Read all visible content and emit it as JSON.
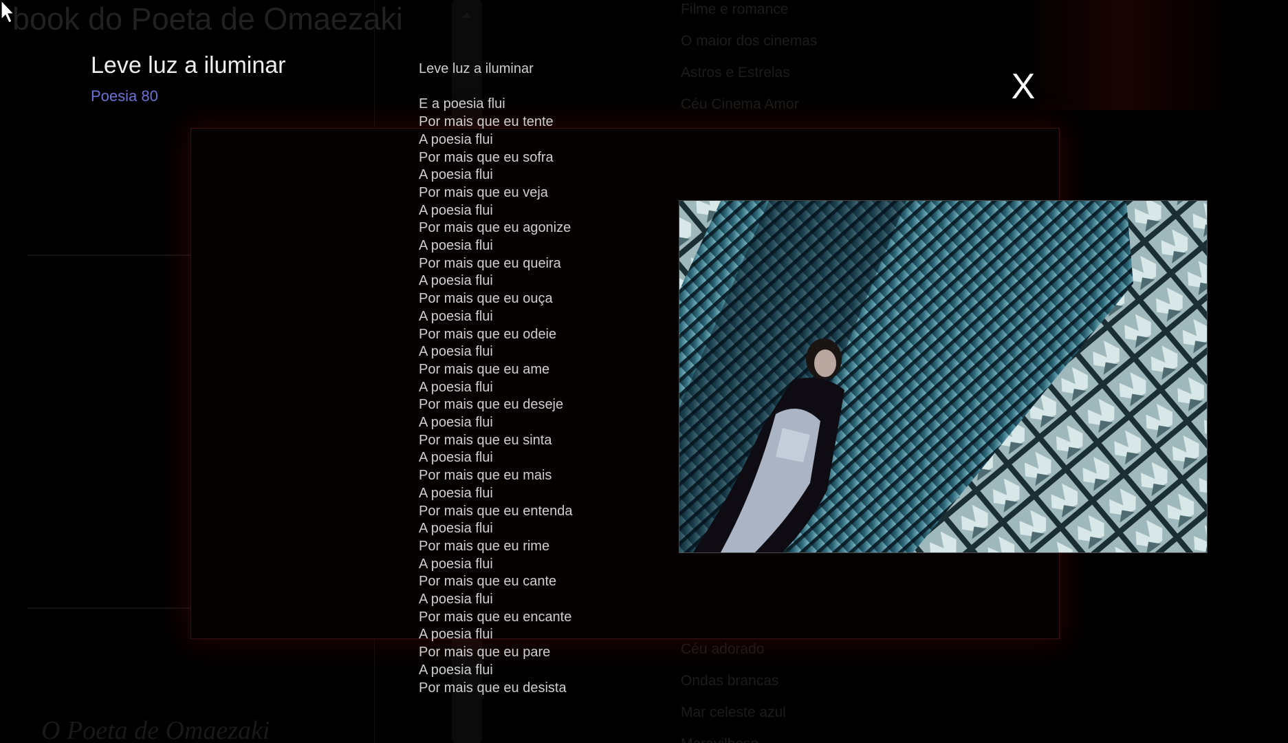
{
  "background": {
    "site_title": "book do Poeta de Omaezaki",
    "nav_links_top": [
      "Filme e romance",
      "O maior dos cinemas",
      "Astros e Estrelas",
      "Céu Cinema Amor"
    ],
    "nav_links_bottom": [
      "Céu adorado",
      "Ondas brancas",
      "Mar celeste azul",
      "Maravilhoso"
    ],
    "footer_title": "O Poeta de Omaezaki"
  },
  "poem": {
    "title": "Leve luz a iluminar",
    "number_label": "Poesia 80",
    "heading": "Leve luz a iluminar",
    "lines": [
      "E a poesia flui",
      "Por mais que eu tente",
      "A poesia flui",
      "Por mais que eu sofra",
      "A poesia flui",
      "Por mais que eu veja",
      "A poesia flui",
      "Por mais que eu agonize",
      "A poesia flui",
      "Por mais que eu queira",
      "A poesia flui",
      "Por mais que eu ouça",
      "A poesia flui",
      "Por mais que eu odeie",
      "A poesia flui",
      "Por mais que eu ame",
      "A poesia flui",
      "Por mais que eu deseje",
      "A poesia flui",
      "Por mais que eu sinta",
      "A poesia flui",
      "Por mais que eu mais",
      "A poesia flui",
      "Por mais que eu entenda",
      "A poesia flui",
      "Por mais que eu rime",
      "A poesia flui",
      "Por mais que eu cante",
      "A poesia flui",
      "Por mais que eu encante",
      "A poesia flui",
      "Por mais que eu pare",
      "A poesia flui",
      "Por mais que eu desista"
    ]
  },
  "overlay": {
    "close_label": "X"
  },
  "icons": {
    "cursor": "mouse-pointer-icon",
    "scroll_up": "scroll-up-arrow-icon"
  },
  "colors": {
    "poem_number": "#6d72d8",
    "frame_border": "#3b1010",
    "text": "#cfcfcf"
  }
}
